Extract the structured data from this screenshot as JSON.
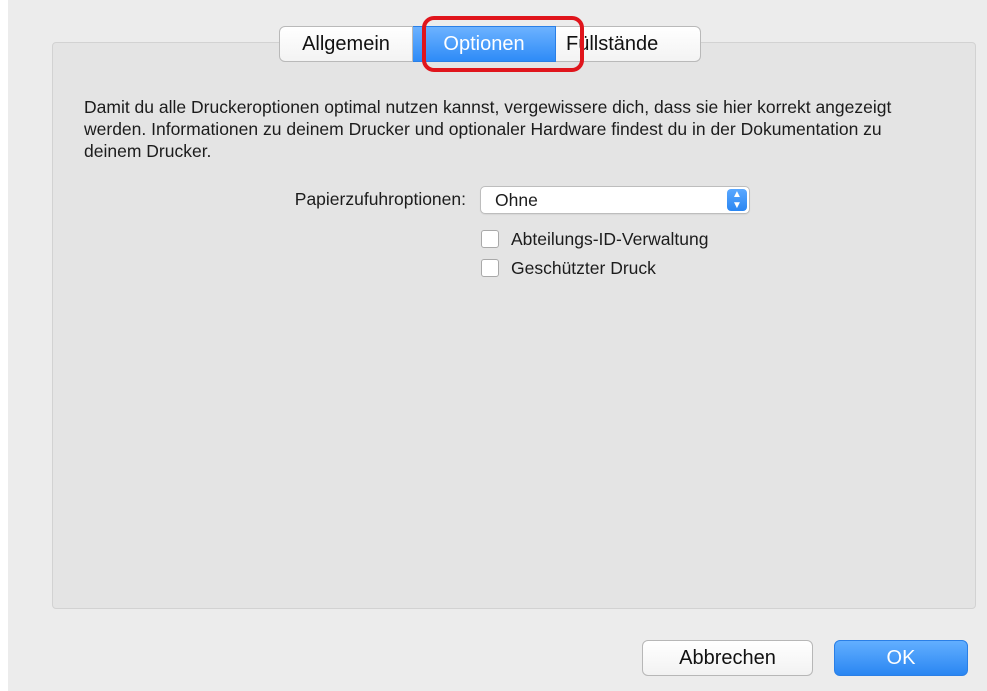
{
  "tabs": [
    {
      "label": "Allgemein",
      "active": false
    },
    {
      "label": "Optionen",
      "active": true
    },
    {
      "label": "Füllstände",
      "active": false
    }
  ],
  "description": "Damit du alle Druckeroptionen optimal nutzen kannst, vergewissere dich, dass sie hier korrekt angezeigt werden. Informationen zu deinem Drucker und optionaler Hardware findest du in der Dokumentation zu deinem Drucker.",
  "paper_feed": {
    "label": "Papierzufuhroptionen:",
    "value": "Ohne"
  },
  "checkboxes": [
    {
      "label": "Abteilungs-ID-Verwaltung",
      "checked": false
    },
    {
      "label": "Geschützter Druck",
      "checked": false
    }
  ],
  "buttons": {
    "cancel": "Abbrechen",
    "ok": "OK"
  },
  "colors": {
    "accent": "#2e8bf7",
    "highlight": "#e0151c"
  }
}
